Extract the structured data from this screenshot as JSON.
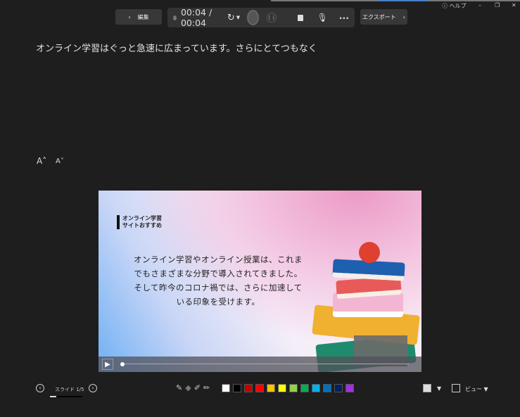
{
  "topbar": {
    "back_label": "編集",
    "time": "00:04 / 00:04",
    "export_label": "エクスポート",
    "help_label": "ヘルプ"
  },
  "notes": {
    "text": "オンライン学習はぐっと急速に広まっています。さらにとてつもなく",
    "font_increase": "A˄",
    "font_decrease": "A˅"
  },
  "slide": {
    "title_line1": "オンライン学習",
    "title_line2": "サイトおすすめ",
    "body": [
      "オンライン学習やオンライン授業は、これま",
      "でもさまざまな分野で導入されてきました。",
      "そして昨今のコロナ禍では、さらに加速して",
      "いる印象を受けます。"
    ]
  },
  "footer": {
    "slide_counter": "スライド 1/5",
    "slide_progress": 0.2,
    "view_label": "ビュー"
  },
  "pen_colors": [
    "#ffffff",
    "#000000",
    "#c00000",
    "#ff0000",
    "#ffc000",
    "#ffff00",
    "#92d050",
    "#00b050",
    "#00b0f0",
    "#0070c0",
    "#002060",
    "#a030e0"
  ]
}
